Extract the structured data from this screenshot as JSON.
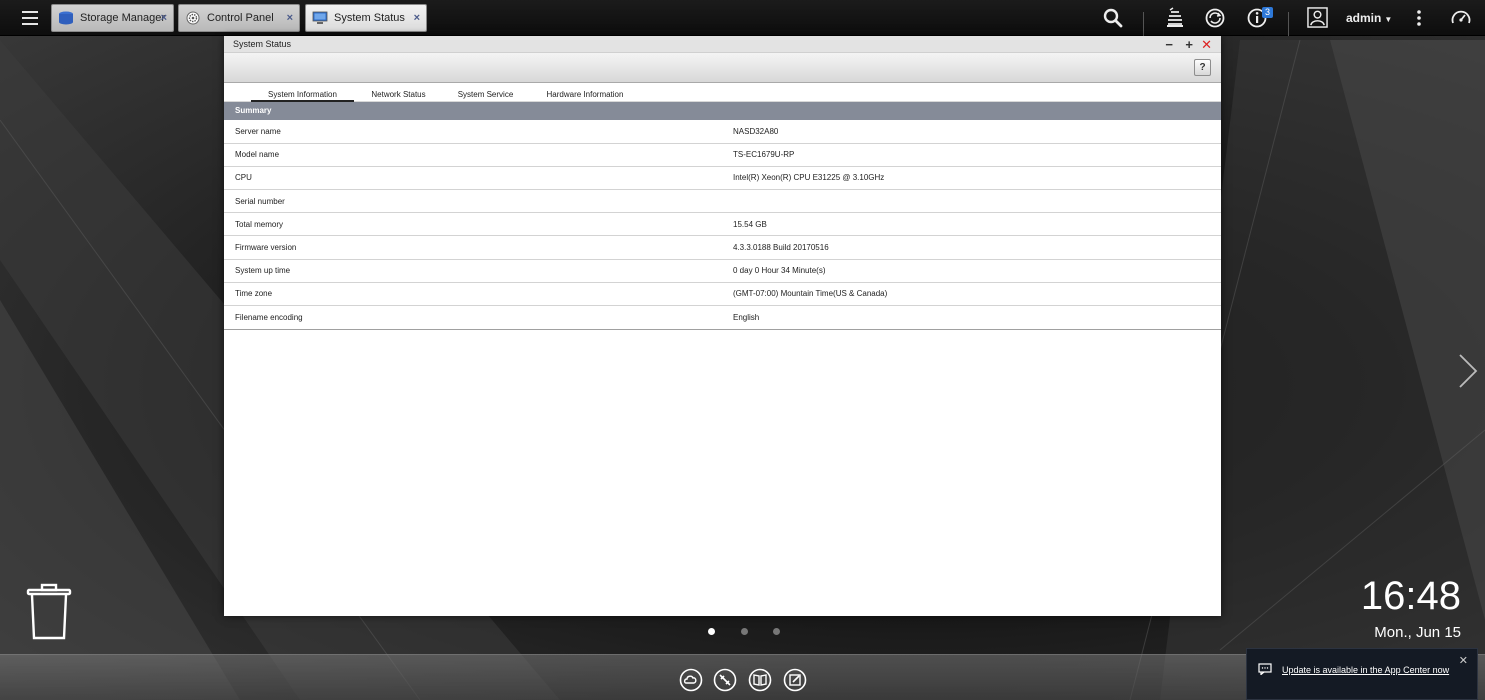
{
  "taskbar": {
    "tabs": [
      {
        "label": "Storage Manager",
        "icon": "database-icon"
      },
      {
        "label": "Control Panel",
        "icon": "gear-icon"
      },
      {
        "label": "System Status",
        "icon": "monitor-icon"
      }
    ],
    "close_glyph": "×",
    "notification_badge": "3",
    "user": "admin",
    "colors": {
      "bar": "#111111",
      "badge": "#2d78d8",
      "active_tab": "#ececec"
    }
  },
  "window": {
    "title": "System Status",
    "help_label": "?",
    "tabs": [
      "System Information",
      "Network Status",
      "System Service",
      "Hardware Information"
    ],
    "active_tab": "System Information",
    "section_title": "Summary",
    "rows": [
      {
        "label": "Server name",
        "value": "NASD32A80"
      },
      {
        "label": "Model name",
        "value": "TS-EC1679U-RP"
      },
      {
        "label": "CPU",
        "value": "Intel(R) Xeon(R) CPU E31225 @ 3.10GHz"
      },
      {
        "label": "Serial number",
        "value": ""
      },
      {
        "label": "Total memory",
        "value": "15.54 GB"
      },
      {
        "label": "Firmware version",
        "value": "4.3.3.0188 Build 20170516"
      },
      {
        "label": "System up time",
        "value": "0 day 0 Hour 34 Minute(s)"
      },
      {
        "label": "Time zone",
        "value": "(GMT-07:00) Mountain Time(US & Canada)"
      },
      {
        "label": "Filename encoding",
        "value": "English"
      }
    ]
  },
  "desktop": {
    "time": "16:48",
    "date": "Mon., Jun 15",
    "pages": 3,
    "active_page": 1
  },
  "notification": {
    "text": "Update is available in the App Center now"
  }
}
